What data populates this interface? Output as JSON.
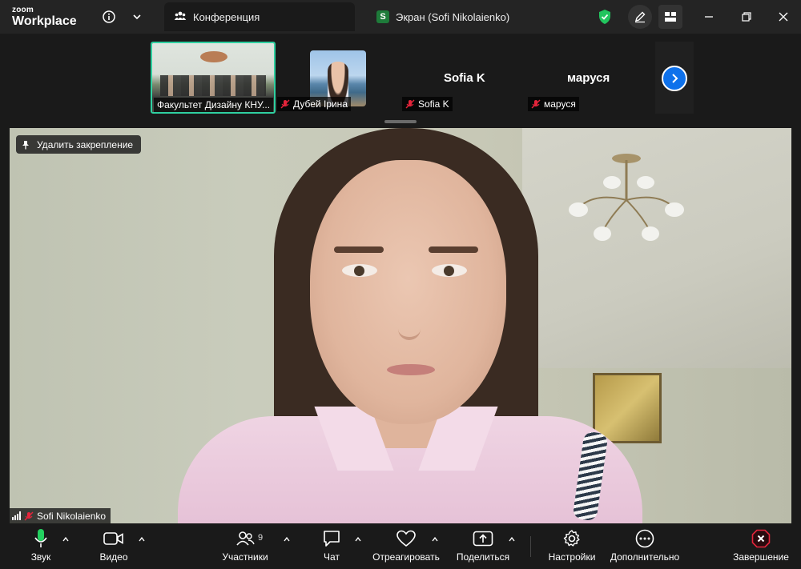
{
  "app": {
    "logo_line1": "zoom",
    "logo_line2": "Workplace"
  },
  "tabs": [
    {
      "label": "Конференция",
      "icon": "people-icon",
      "active": true
    },
    {
      "label": "Экран (Sofi Nikolaienko)",
      "badge": "S",
      "active": false
    }
  ],
  "thumbnails": [
    {
      "name": "Факультет Дизайну КНУ...",
      "muted": false,
      "has_video": true
    },
    {
      "name": "Дубей Ірина",
      "muted": true,
      "has_video": true
    },
    {
      "name": "Sofia K",
      "display_name": "Sofia K",
      "muted": true,
      "has_video": false
    },
    {
      "name": "маруся",
      "display_name": "маруся",
      "muted": true,
      "has_video": false
    }
  ],
  "main": {
    "unpin_label": "Удалить закрепление",
    "speaker_name": "Sofi Nikolaienko",
    "speaker_muted": true
  },
  "toolbar": {
    "audio": "Звук",
    "video": "Видео",
    "participants": "Участники",
    "participants_count": "9",
    "chat": "Чат",
    "react": "Отреагировать",
    "share": "Поделиться",
    "settings": "Настройки",
    "more": "Дополнительно",
    "end": "Завершение"
  },
  "colors": {
    "accent_green": "#2fd0a0",
    "shield_green": "#22c55e",
    "blue": "#0e71eb",
    "end_red": "#e5243b",
    "mic_green": "#23d160"
  }
}
